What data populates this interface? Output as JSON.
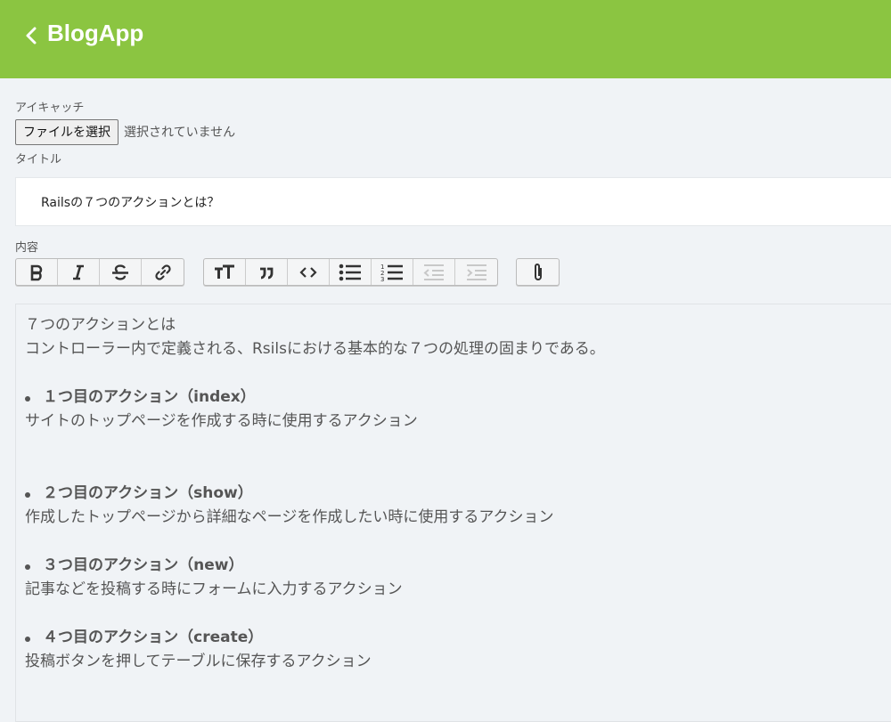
{
  "header": {
    "title": "BlogApp",
    "back_icon": "chevron-left-icon",
    "bg_color": "#8bc541"
  },
  "form": {
    "eyecatch_label": "アイキャッチ",
    "file_button_label": "ファイルを選択",
    "file_status": "選択されていません",
    "title_label": "タイトル",
    "title_value": "Railsの７つのアクションとは？",
    "content_label": "内容"
  },
  "toolbar": {
    "groups": [
      [
        "bold-icon",
        "italic-icon",
        "strikethrough-icon",
        "link-icon"
      ],
      [
        "heading-icon",
        "quote-icon",
        "code-icon",
        "bullet-list-icon",
        "numbered-list-icon",
        "decrease-indent-icon",
        "increase-indent-icon"
      ],
      [
        "attachment-icon"
      ]
    ]
  },
  "editor": {
    "intro_heading": "７つのアクションとは",
    "intro_text": "コントローラー内で定義される、Rsilsにおける基本的な７つの処理の固まりである。",
    "actions": [
      {
        "title": "１つ目のアクション（index）",
        "desc": "サイトのトップページを作成する時に使用するアクション"
      },
      {
        "title": "２つ目のアクション（show）",
        "desc": "作成したトップページから詳細なページを作成したい時に使用するアクション"
      },
      {
        "title": "３つ目のアクション（new）",
        "desc": "記事などを投稿する時にフォームに入力するアクション"
      },
      {
        "title": "４つ目のアクション（create）",
        "desc": "投稿ボタンを押してテーブルに保存するアクション"
      }
    ]
  }
}
